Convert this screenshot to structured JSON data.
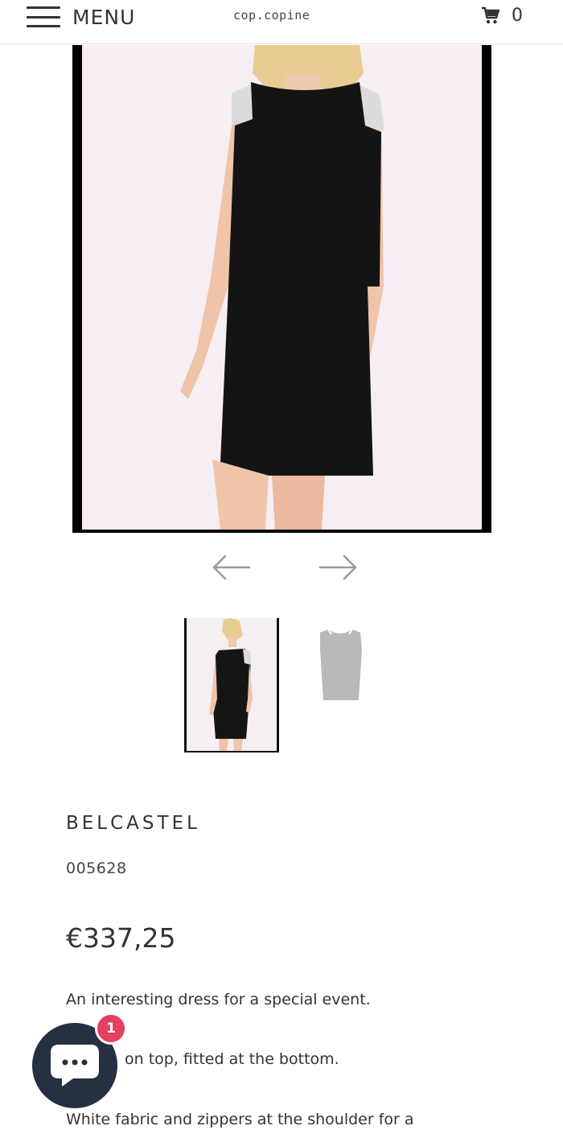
{
  "header": {
    "menu_label": "MENU",
    "brand": "cop.copine",
    "cart_count": "0"
  },
  "gallery": {
    "prev_icon": "arrow-left-icon",
    "next_icon": "arrow-right-icon",
    "thumbnail_count": 2
  },
  "product": {
    "name": "BELCASTEL",
    "sku": "005628",
    "price": "€337,25",
    "description": [
      "An interesting dress for a  special event.",
      "on top, fitted at the bottom.",
      "White fabric and zippers at the shoulder for a"
    ]
  },
  "chat": {
    "icon": "chat-bubble-icon",
    "badge_count": "1",
    "badge_color": "#e5405f",
    "bubble_color": "#253040"
  }
}
